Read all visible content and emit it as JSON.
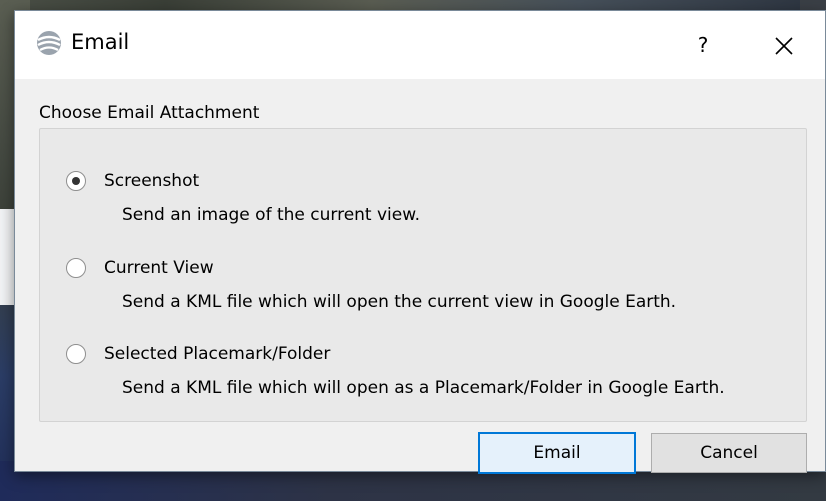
{
  "dialog": {
    "title": "Email",
    "help_label": "?",
    "close_label": "✕"
  },
  "group": {
    "title": "Choose Email Attachment"
  },
  "options": [
    {
      "label": "Screenshot",
      "description": "Send an image of the current view.",
      "selected": true
    },
    {
      "label": "Current View",
      "description": "Send a KML file which will open the current view in Google Earth.",
      "selected": false
    },
    {
      "label": "Selected Placemark/Folder",
      "description": "Send a KML file which will open as a Placemark/Folder in Google Earth.",
      "selected": false
    }
  ],
  "buttons": {
    "email_label": "Email",
    "cancel_label": "Cancel"
  },
  "colors": {
    "accent": "#0078d7",
    "dialog_bg": "#f0f0f0"
  },
  "icons": {
    "app": "google-earth-icon",
    "close": "close-icon"
  }
}
